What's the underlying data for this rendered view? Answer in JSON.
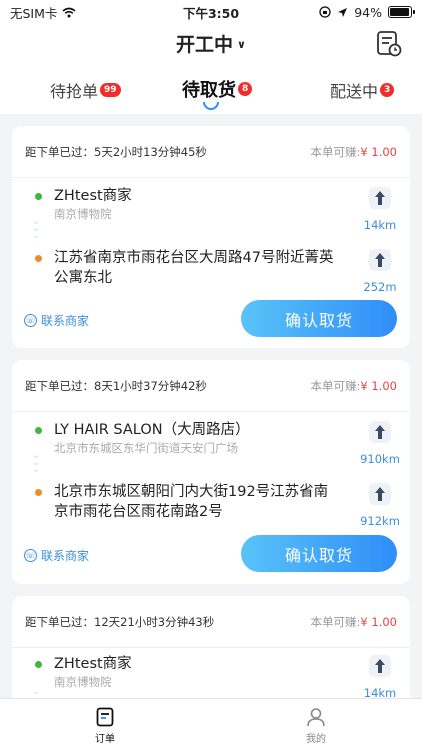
{
  "status_bar": {
    "carrier": "无SIM卡",
    "time": "下午3:50",
    "battery": "94%",
    "battery_level": 0.94
  },
  "header": {
    "title": "开工中"
  },
  "tabs": [
    {
      "label": "待抢单",
      "badge": "99"
    },
    {
      "label": "待取货",
      "badge": "8"
    },
    {
      "label": "配送中",
      "badge": "3"
    }
  ],
  "orders": [
    {
      "elapsed": "距下单已过：5天2小时13分钟45秒",
      "earn_label": "本单可赚:",
      "earn_amount": "¥ 1.00",
      "pickup": {
        "name": "ZHtest商家",
        "address": "南京博物院",
        "distance": "14km"
      },
      "dropoff": {
        "address": "江苏省南京市雨花台区大周路47号附近菁英公寓东北",
        "distance": "252m"
      },
      "contact_label": "联系商家",
      "confirm_label": "确认取货"
    },
    {
      "elapsed": "距下单已过：8天1小时37分钟42秒",
      "earn_label": "本单可赚:",
      "earn_amount": "¥ 1.00",
      "pickup": {
        "name": "LY HAIR SALON（大周路店）",
        "address": "北京市东城区东华门街道天安门广场",
        "distance": "910km"
      },
      "dropoff": {
        "address": "北京市东城区朝阳门内大街192号江苏省南京市雨花台区雨花南路2号",
        "distance": "912km"
      },
      "contact_label": "联系商家",
      "confirm_label": "确认取货"
    },
    {
      "elapsed": "距下单已过：12天21小时3分钟43秒",
      "earn_label": "本单可赚:",
      "earn_amount": "¥ 1.00",
      "pickup": {
        "name": "ZHtest商家",
        "address": "南京博物院",
        "distance": "14km"
      }
    }
  ],
  "bottom_nav": [
    {
      "label": "订单",
      "icon": "order-icon",
      "active": true
    },
    {
      "label": "我的",
      "icon": "user-icon",
      "active": false
    }
  ],
  "colors": {
    "accent": "#2f8ef8",
    "price": "#f04040",
    "link": "#3b8fd8"
  }
}
